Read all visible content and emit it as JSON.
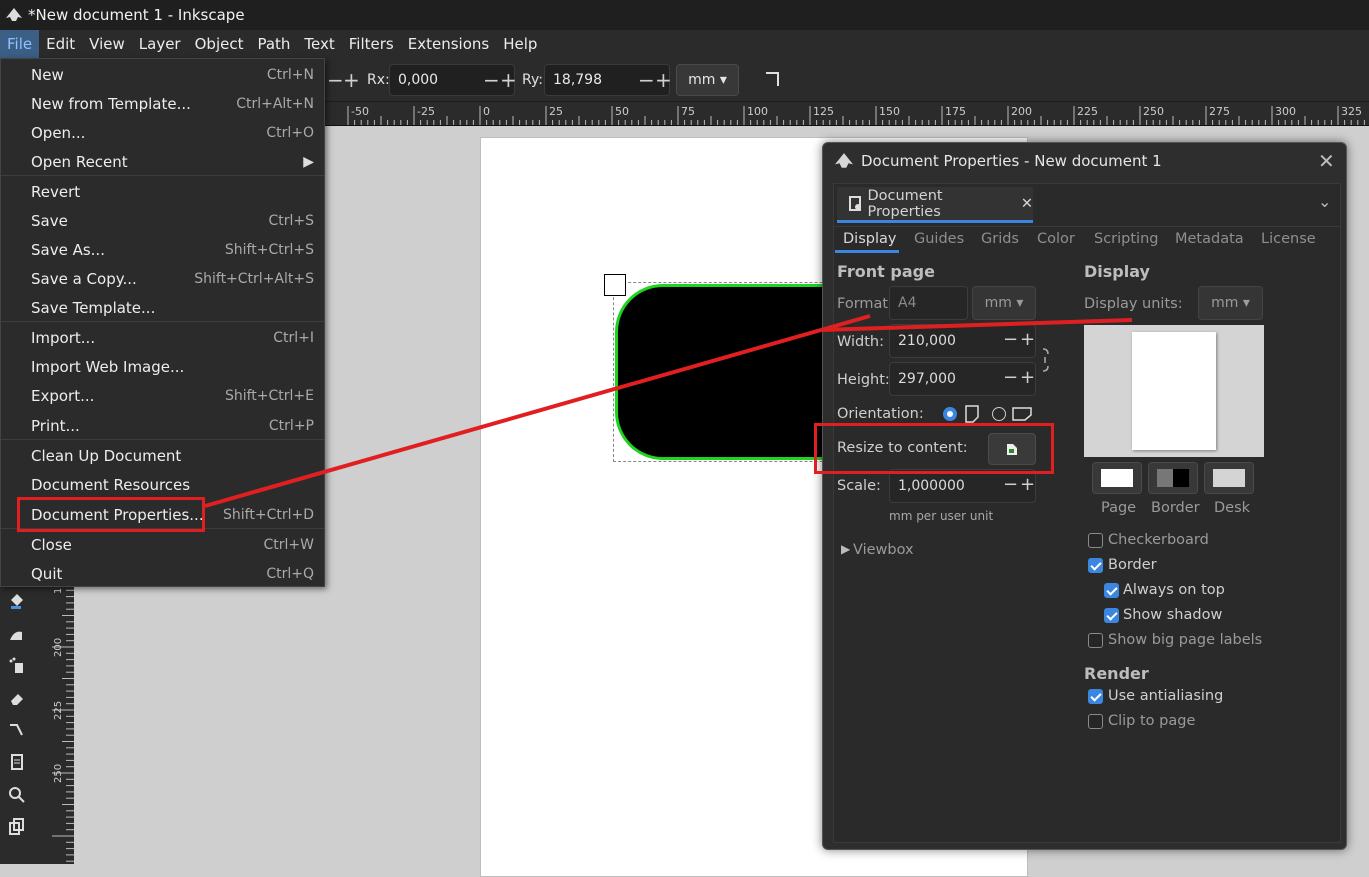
{
  "window": {
    "title": "*New document 1 - Inkscape"
  },
  "menubar": [
    "File",
    "Edit",
    "View",
    "Layer",
    "Object",
    "Path",
    "Text",
    "Filters",
    "Extensions",
    "Help"
  ],
  "toolbar": {
    "rx_label": "Rx:",
    "rx_value": "0,000",
    "ry_label": "Ry:",
    "ry_value": "18,798",
    "unit": "mm"
  },
  "ruler_h": [
    "-50",
    "-25",
    "0",
    "25",
    "50",
    "75",
    "100",
    "125",
    "150",
    "175",
    "200",
    "225",
    "250",
    "275",
    "300",
    "325"
  ],
  "ruler_v": [
    "175",
    "200",
    "225",
    "250"
  ],
  "file_menu": [
    {
      "label": "New",
      "shortcut": "Ctrl+N"
    },
    {
      "label": "New from Template...",
      "shortcut": "Ctrl+Alt+N"
    },
    {
      "label": "Open...",
      "shortcut": "Ctrl+O"
    },
    {
      "label": "Open Recent",
      "shortcut": ""
    },
    {
      "label": "Revert",
      "shortcut": ""
    },
    {
      "label": "Save",
      "shortcut": "Ctrl+S"
    },
    {
      "label": "Save As...",
      "shortcut": "Shift+Ctrl+S"
    },
    {
      "label": "Save a Copy...",
      "shortcut": "Shift+Ctrl+Alt+S"
    },
    {
      "label": "Save Template...",
      "shortcut": ""
    },
    {
      "label": "Import...",
      "shortcut": "Ctrl+I"
    },
    {
      "label": "Import Web Image...",
      "shortcut": ""
    },
    {
      "label": "Export...",
      "shortcut": "Shift+Ctrl+E"
    },
    {
      "label": "Print...",
      "shortcut": "Ctrl+P"
    },
    {
      "label": "Clean Up Document",
      "shortcut": ""
    },
    {
      "label": "Document Resources",
      "shortcut": ""
    },
    {
      "label": "Document Properties...",
      "shortcut": "Shift+Ctrl+D"
    },
    {
      "label": "Close",
      "shortcut": "Ctrl+W"
    },
    {
      "label": "Quit",
      "shortcut": "Ctrl+Q"
    }
  ],
  "dialog": {
    "title": "Document Properties - New document 1",
    "tab_label": "Document Properties",
    "subtabs": [
      "Display",
      "Guides",
      "Grids",
      "Color",
      "Scripting",
      "Metadata",
      "License"
    ],
    "front_page": {
      "heading": "Front page",
      "format_label": "Format:",
      "format_value": "A4",
      "format_unit": "mm",
      "width_label": "Width:",
      "width_value": "210,000",
      "height_label": "Height:",
      "height_value": "297,000",
      "orientation_label": "Orientation:",
      "resize_label": "Resize to content:",
      "scale_label": "Scale:",
      "scale_value": "1,000000",
      "scale_note": "mm per user unit",
      "viewbox_label": "Viewbox"
    },
    "display": {
      "heading": "Display",
      "units_label": "Display units:",
      "units_value": "mm",
      "swatches": [
        "Page",
        "Border",
        "Desk"
      ],
      "checkboxes": [
        {
          "label": "Checkerboard",
          "checked": false
        },
        {
          "label": "Border",
          "checked": true
        },
        {
          "label": "Always on top",
          "checked": true
        },
        {
          "label": "Show shadow",
          "checked": true
        },
        {
          "label": "Show big page labels",
          "checked": false
        }
      ],
      "render_heading": "Render",
      "render_checkboxes": [
        {
          "label": "Use antialiasing",
          "checked": true
        },
        {
          "label": "Clip to page",
          "checked": false
        }
      ]
    }
  },
  "colors": {
    "accent": "#3b87e0",
    "highlight_box": "#e02020",
    "shape_stroke": "#1ed41e"
  }
}
